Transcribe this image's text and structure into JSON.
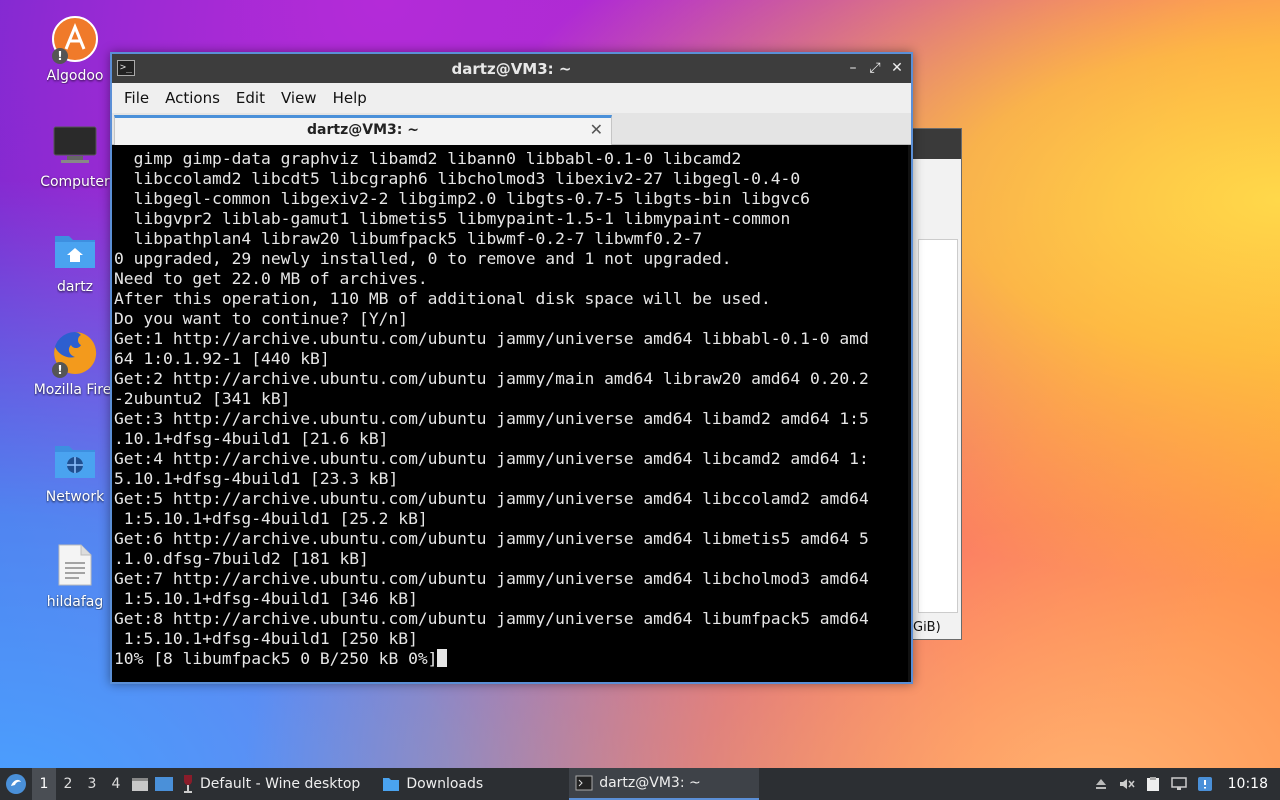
{
  "desktop": {
    "icons": [
      {
        "label": "Algodoo"
      },
      {
        "label": "Computer"
      },
      {
        "label": "dartz"
      },
      {
        "label": "Mozilla Firef"
      },
      {
        "label": "Network"
      },
      {
        "label": "hildafag"
      }
    ]
  },
  "background_window": {
    "partial_text": "GiB)"
  },
  "terminal": {
    "title": "dartz@VM3: ~",
    "menu": [
      "File",
      "Actions",
      "Edit",
      "View",
      "Help"
    ],
    "tab_label": "dartz@VM3: ~",
    "lines": [
      "  gimp gimp-data graphviz libamd2 libann0 libbabl-0.1-0 libcamd2",
      "  libccolamd2 libcdt5 libcgraph6 libcholmod3 libexiv2-27 libgegl-0.4-0",
      "  libgegl-common libgexiv2-2 libgimp2.0 libgts-0.7-5 libgts-bin libgvc6",
      "  libgvpr2 liblab-gamut1 libmetis5 libmypaint-1.5-1 libmypaint-common",
      "  libpathplan4 libraw20 libumfpack5 libwmf-0.2-7 libwmf0.2-7",
      "0 upgraded, 29 newly installed, 0 to remove and 1 not upgraded.",
      "Need to get 22.0 MB of archives.",
      "After this operation, 110 MB of additional disk space will be used.",
      "Do you want to continue? [Y/n]",
      "Get:1 http://archive.ubuntu.com/ubuntu jammy/universe amd64 libbabl-0.1-0 amd",
      "64 1:0.1.92-1 [440 kB]",
      "Get:2 http://archive.ubuntu.com/ubuntu jammy/main amd64 libraw20 amd64 0.20.2",
      "-2ubuntu2 [341 kB]",
      "Get:3 http://archive.ubuntu.com/ubuntu jammy/universe amd64 libamd2 amd64 1:5",
      ".10.1+dfsg-4build1 [21.6 kB]",
      "Get:4 http://archive.ubuntu.com/ubuntu jammy/universe amd64 libcamd2 amd64 1:",
      "5.10.1+dfsg-4build1 [23.3 kB]",
      "Get:5 http://archive.ubuntu.com/ubuntu jammy/universe amd64 libccolamd2 amd64",
      " 1:5.10.1+dfsg-4build1 [25.2 kB]",
      "Get:6 http://archive.ubuntu.com/ubuntu jammy/universe amd64 libmetis5 amd64 5",
      ".1.0.dfsg-7build2 [181 kB]",
      "Get:7 http://archive.ubuntu.com/ubuntu jammy/universe amd64 libcholmod3 amd64",
      " 1:5.10.1+dfsg-4build1 [346 kB]",
      "Get:8 http://archive.ubuntu.com/ubuntu jammy/universe amd64 libumfpack5 amd64",
      " 1:5.10.1+dfsg-4build1 [250 kB]",
      "10% [8 libumfpack5 0 B/250 kB 0%]"
    ]
  },
  "taskbar": {
    "workspaces": [
      "1",
      "2",
      "3",
      "4"
    ],
    "active_workspace": "1",
    "tasks": [
      {
        "label": "Default - Wine desktop",
        "icon": "wine-icon"
      },
      {
        "label": "Downloads",
        "icon": "folder-icon"
      },
      {
        "label": "dartz@VM3: ~",
        "icon": "terminal-icon"
      }
    ],
    "clock": "10:18"
  },
  "colors": {
    "accent": "#5b8fd6",
    "terminal_bg": "#000000",
    "terminal_fg": "#e6e6e6",
    "taskbar_bg": "#2c2f33"
  }
}
